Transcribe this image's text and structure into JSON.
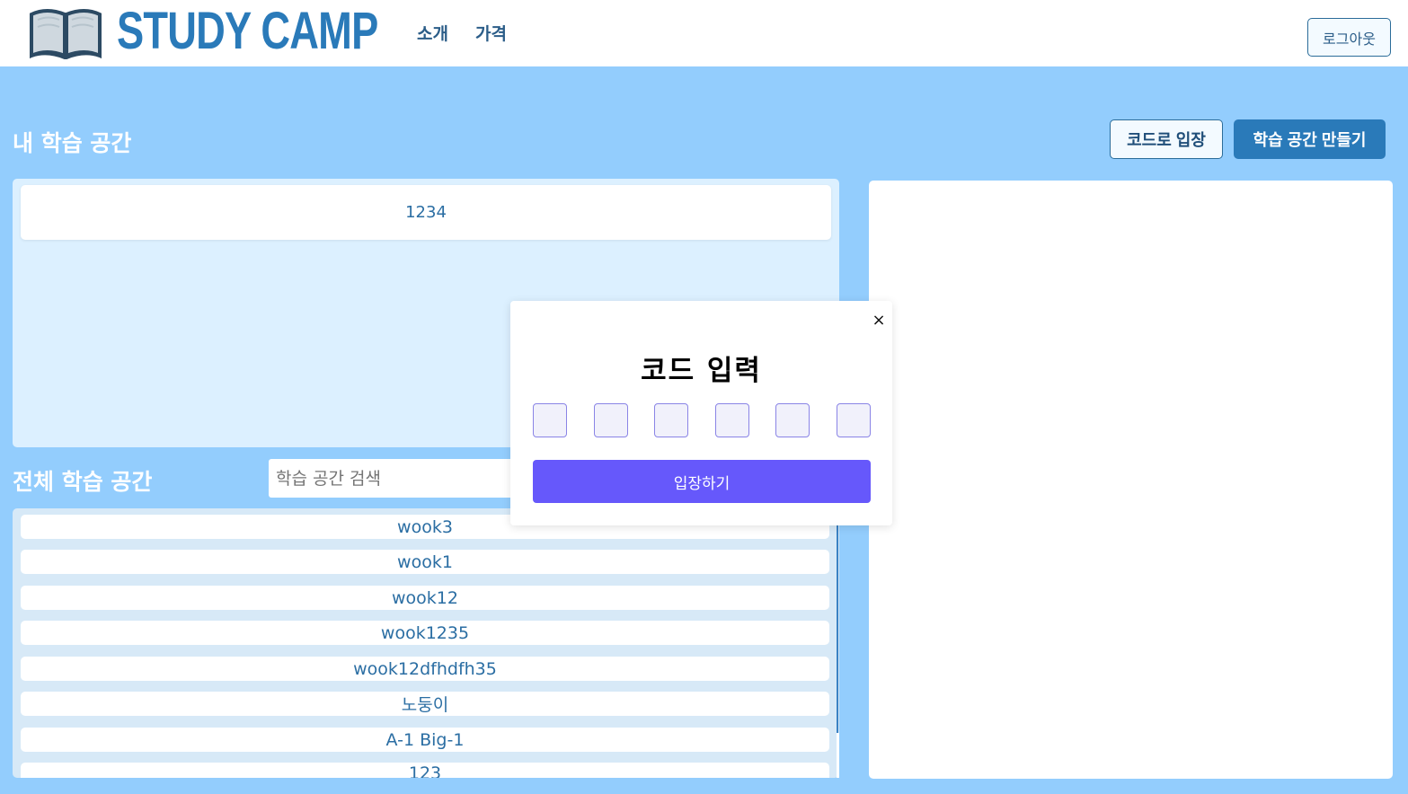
{
  "header": {
    "logo_text": "STUDY CAMP",
    "nav": [
      "소개",
      "가격"
    ],
    "logout_label": "로그아웃"
  },
  "my_space": {
    "title": "내 학습 공간",
    "code_enter_label": "코드로 입장",
    "create_label": "학습 공간 만들기",
    "items": [
      "1234"
    ]
  },
  "all_space": {
    "title": "전체 학습 공간",
    "search_placeholder": "학습 공간 검색",
    "items": [
      "wook3",
      "wook1",
      "wook12",
      "wook1235",
      "wook12dfhdfh35",
      "노둥이",
      "A-1 Big-1",
      "123"
    ]
  },
  "modal": {
    "close_icon": "×",
    "title": "코드 입력",
    "code_digits": [
      "",
      "",
      "",
      "",
      "",
      ""
    ],
    "submit_label": "입장하기"
  },
  "colors": {
    "background": "#93cdfd",
    "brand": "#2a7ab9",
    "modal_button": "#6658fb"
  }
}
